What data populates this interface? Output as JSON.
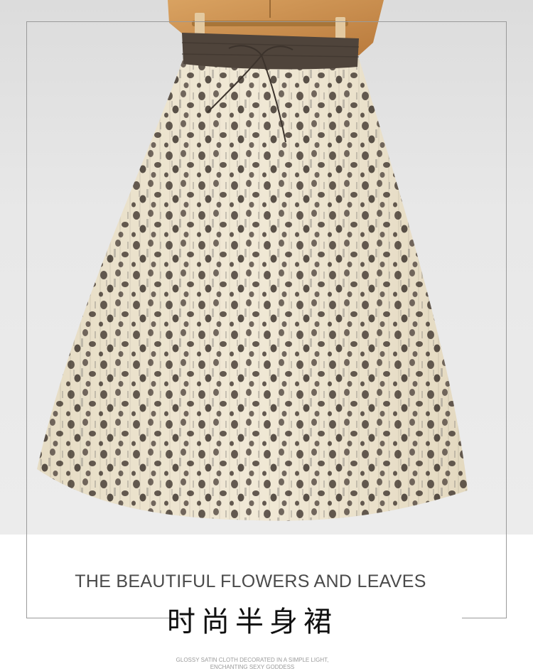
{
  "product": {
    "image_alt": "Printed chiffon midi skirt with elastic drawstring waist on wooden hanger",
    "heading_en": "THE BEAUTIFUL FLOWERS AND LEAVES",
    "heading_cn": "时尚半身裙",
    "description_line1": "GLOSSY SATIN CLOTH DECORATED IN A SIMPLE LIGHT,",
    "description_line2": "ENCHANTING SEXY GODDESS"
  },
  "colors": {
    "fabric": "#ece3cd",
    "spots": "#4a4038",
    "waistband": "#4f443b",
    "hanger": "#c98f4d",
    "background": "#e6e6e6"
  }
}
